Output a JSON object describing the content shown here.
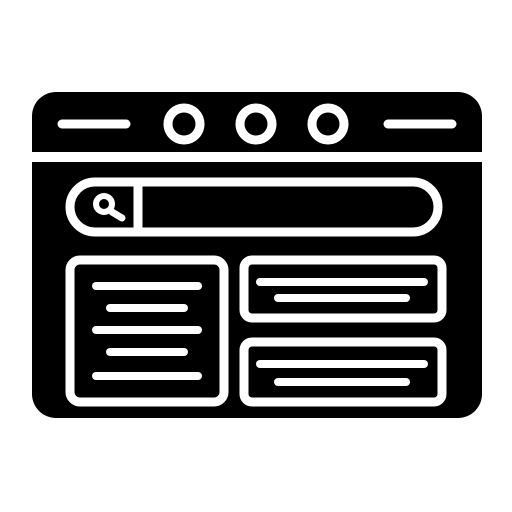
{
  "icon": {
    "name": "browser-window-layout-icon",
    "foreground_color": "#000000",
    "background_color": "#ffffff",
    "parts": {
      "window": "browser-window",
      "title_bar": "title-bar",
      "window_buttons": [
        "window-button-circle",
        "window-button-circle",
        "window-button-circle"
      ],
      "search_bar": "search-bar",
      "search_icon": "search-icon",
      "left_card": "content-card-left",
      "right_cards": [
        "content-card-top-right",
        "content-card-bottom-right"
      ]
    }
  }
}
